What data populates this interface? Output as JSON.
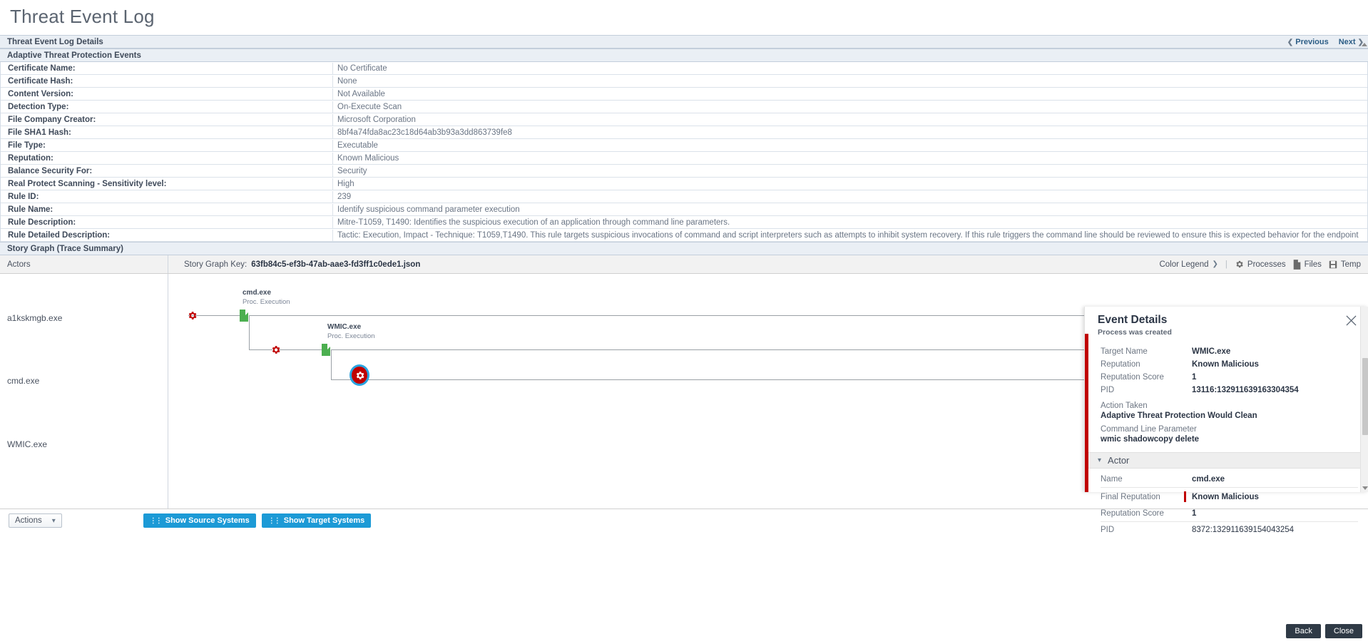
{
  "page": {
    "title": "Threat Event Log"
  },
  "panel": {
    "header": "Threat Event Log Details",
    "previous": "Previous",
    "next": "Next",
    "section": "Adaptive Threat Protection Events"
  },
  "details": [
    {
      "key": "Certificate Name:",
      "value": "No Certificate"
    },
    {
      "key": "Certificate Hash:",
      "value": "None"
    },
    {
      "key": "Content Version:",
      "value": "Not Available"
    },
    {
      "key": "Detection Type:",
      "value": "On-Execute Scan"
    },
    {
      "key": "File Company Creator:",
      "value": "Microsoft Corporation"
    },
    {
      "key": "File SHA1 Hash:",
      "value": "8bf4a74fda8ac23c18d64ab3b93a3dd863739fe8"
    },
    {
      "key": "File Type:",
      "value": "Executable"
    },
    {
      "key": "Reputation:",
      "value": "Known Malicious"
    },
    {
      "key": "Balance Security For:",
      "value": "Security"
    },
    {
      "key": "Real Protect Scanning - Sensitivity level:",
      "value": "High"
    },
    {
      "key": "Rule ID:",
      "value": "239"
    },
    {
      "key": "Rule Name:",
      "value": "Identify suspicious command parameter execution"
    },
    {
      "key": "Rule Description:",
      "value": "Mitre-T1059, T1490: Identifies the suspicious execution of an application through command line parameters."
    },
    {
      "key": "Rule Detailed Description:",
      "value": "Tactic: Execution, Impact - Technique: T1059,T1490. This rule targets suspicious invocations of command and script interpreters such as attempts to inhibit system recovery. If this rule triggers the command line should be reviewed to ensure this is expected behavior for the endpoint"
    }
  ],
  "story_graph": {
    "header": "Story Graph (Trace Summary)",
    "actors_col": "Actors",
    "key_label": "Story Graph Key:",
    "key_value": "63fb84c5-ef3b-47ab-aae3-fd3ff1c0ede1.json",
    "color_legend": "Color Legend",
    "tools": [
      {
        "label": "Processes",
        "icon": "gear-icon"
      },
      {
        "label": "Files",
        "icon": "file-icon"
      },
      {
        "label": "Temp",
        "icon": "floppy-icon"
      }
    ],
    "actors": [
      "a1kskmgb.exe",
      "cmd.exe",
      "WMIC.exe"
    ],
    "nodes": [
      {
        "title": "cmd.exe",
        "subtitle": "Proc. Execution"
      },
      {
        "title": "WMIC.exe",
        "subtitle": "Proc. Execution"
      }
    ]
  },
  "actions": {
    "actions_label": "Actions",
    "show_source": "Show Source Systems",
    "show_target": "Show Target Systems"
  },
  "event_details": {
    "title": "Event Details",
    "subtitle": "Process was created",
    "rows": [
      {
        "key": "Target Name",
        "value": "WMIC.exe"
      },
      {
        "key": "Reputation",
        "value": "Known Malicious"
      },
      {
        "key": "Reputation Score",
        "value": "1"
      },
      {
        "key": "PID",
        "value": "13116:132911639163304354"
      }
    ],
    "blocks": [
      {
        "key": "Action Taken",
        "value": "Adaptive Threat Protection Would Clean"
      },
      {
        "key": "Command Line Parameter",
        "value": "wmic shadowcopy delete"
      }
    ],
    "actor_section": "Actor",
    "actor_rows": [
      {
        "key": "Name",
        "value": "cmd.exe"
      },
      {
        "key": "Final Reputation",
        "value": "Known Malicious"
      },
      {
        "key": "Reputation Score",
        "value": "1"
      },
      {
        "key": "PID",
        "value": "8372:132911639154043254"
      }
    ]
  },
  "footer": {
    "back": "Back",
    "close": "Close"
  },
  "colors": {
    "accent_blue": "#1c9ad6",
    "malicious_red": "#c00000",
    "process_green": "#4caf50"
  }
}
